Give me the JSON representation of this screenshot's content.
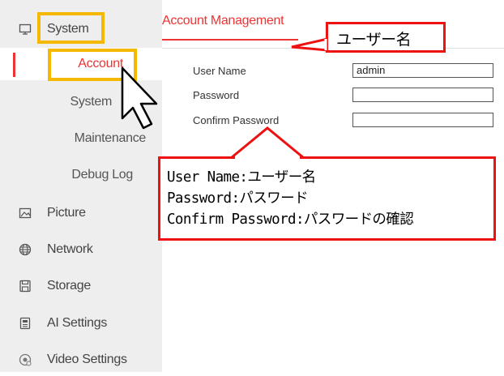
{
  "sidebar": {
    "items": [
      {
        "label": "System",
        "icon": "monitor-icon"
      },
      {
        "label": "Picture",
        "icon": "picture-icon"
      },
      {
        "label": "Network",
        "icon": "globe-icon"
      },
      {
        "label": "Storage",
        "icon": "storage-icon"
      },
      {
        "label": "AI Settings",
        "icon": "ai-settings-icon"
      },
      {
        "label": "Video Settings",
        "icon": "video-settings-icon"
      }
    ],
    "subitems": [
      {
        "label": "Account"
      },
      {
        "label": "System"
      },
      {
        "label": "Maintenance"
      },
      {
        "label": "Debug Log"
      }
    ]
  },
  "main": {
    "tab_title": "Account Management",
    "fields": [
      {
        "label": "User Name",
        "value": "admin"
      },
      {
        "label": "Password",
        "value": ""
      },
      {
        "label": "Confirm Password",
        "value": ""
      }
    ]
  },
  "annotations": {
    "small_callout": "ユーザー名",
    "big_callout": [
      "User Name:ユーザー名",
      "Password:パスワード",
      "Confirm Password:パスワードの確認"
    ]
  },
  "colors": {
    "accent": "#e33333",
    "highlight": "#f5b800",
    "callout_border": "#e11111",
    "sidebar_bg": "#eeeeee"
  }
}
